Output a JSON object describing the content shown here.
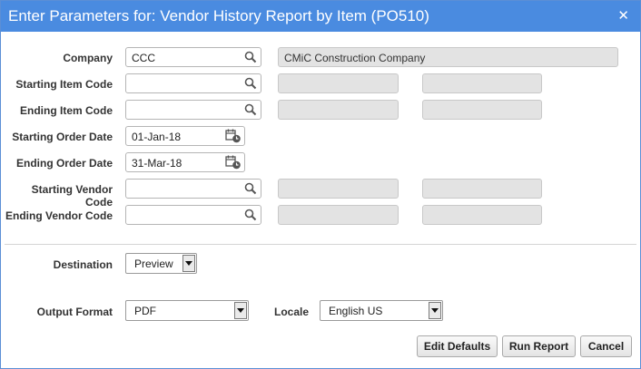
{
  "dialog": {
    "title": "Enter Parameters for: Vendor History Report by Item (PO510)",
    "close_glyph": "✕"
  },
  "fields": {
    "company": {
      "label": "Company",
      "value": "CCC",
      "description": "CMiC Construction Company"
    },
    "starting_item_code": {
      "label": "Starting Item Code",
      "value": ""
    },
    "ending_item_code": {
      "label": "Ending Item Code",
      "value": ""
    },
    "starting_order_date": {
      "label": "Starting Order Date",
      "value": "01-Jan-18"
    },
    "ending_order_date": {
      "label": "Ending Order Date",
      "value": "31-Mar-18"
    },
    "starting_vendor_code": {
      "label": "Starting Vendor Code",
      "value": ""
    },
    "ending_vendor_code": {
      "label": "Ending Vendor Code",
      "value": ""
    }
  },
  "output": {
    "destination_label": "Destination",
    "destination_value": "Preview",
    "format_label": "Output Format",
    "format_value": "PDF",
    "locale_label": "Locale",
    "locale_value": "English US"
  },
  "buttons": {
    "edit_defaults": "Edit Defaults",
    "run_report": "Run Report",
    "cancel": "Cancel"
  },
  "icons": {
    "lookup": "search-icon",
    "date": "calendar-icon",
    "dropdown": "dropdown-arrow-icon"
  }
}
